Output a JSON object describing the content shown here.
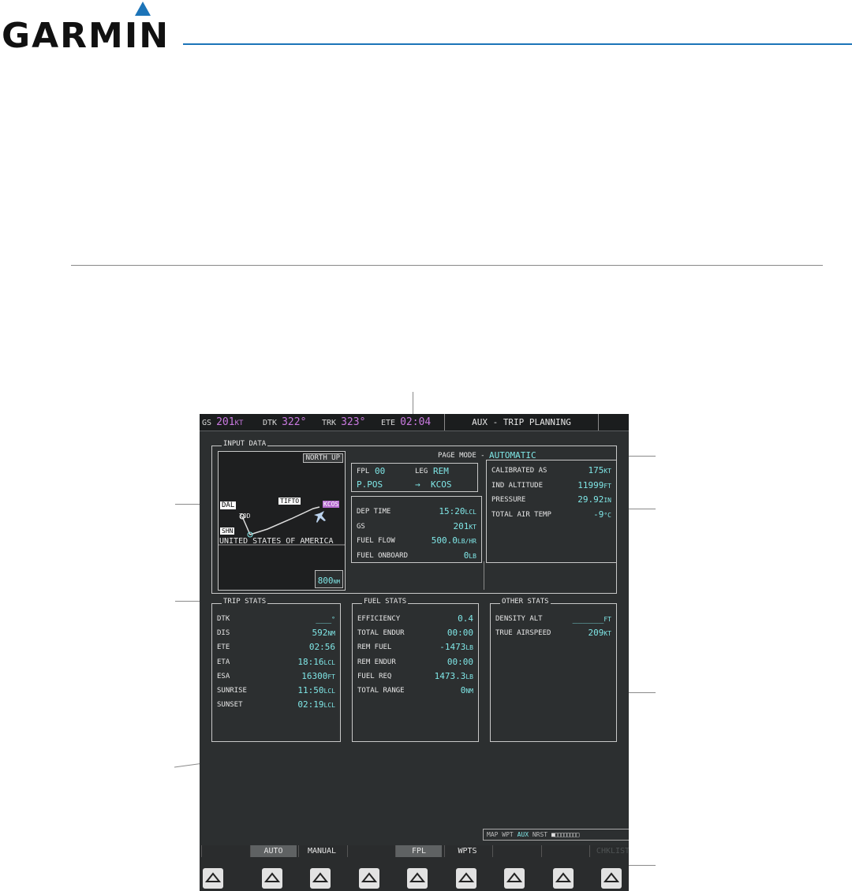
{
  "brand": {
    "name": "GARMIN",
    "reg": "®"
  },
  "topbar": {
    "gs_label": "GS",
    "gs_value": "201",
    "gs_unit": "KT",
    "dtk_label": "DTK",
    "dtk_value": "322°",
    "trk_label": "TRK",
    "trk_value": "323°",
    "ete_label": "ETE",
    "ete_value": "02:04",
    "page_title": "AUX - TRIP PLANNING"
  },
  "input_data": {
    "title": "INPUT DATA",
    "page_mode_label": "PAGE MODE -",
    "page_mode_value": "AUTOMATIC",
    "fpl_label": "FPL",
    "fpl_value": "00",
    "leg_label": "LEG",
    "leg_value": "REM",
    "from": "P.POS",
    "arrow": "→",
    "to": "KCOS",
    "map": {
      "north_up": "NORTH UP",
      "range": "800",
      "range_unit": "NM",
      "labels": {
        "dal": "DAL",
        "shn": "SHN",
        "tifto": "TIFTO",
        "kcos": "KCOS",
        "tod": "TOD",
        "country": "UNITED STATES OF AMERICA"
      }
    },
    "rows": [
      {
        "label": "DEP TIME",
        "value": "15:20",
        "unit": "LCL"
      },
      {
        "label": "GS",
        "value": "201",
        "unit": "KT"
      },
      {
        "label": "FUEL FLOW",
        "value": "500.0",
        "unit": "LB/HR"
      },
      {
        "label": "FUEL ONBOARD",
        "value": "0",
        "unit": "LB"
      }
    ],
    "air_rows": [
      {
        "label": "CALIBRATED AS",
        "value": "175",
        "unit": "KT"
      },
      {
        "label": "IND ALTITUDE",
        "value": "11999",
        "unit": "FT"
      },
      {
        "label": "PRESSURE",
        "value": "29.92",
        "unit": "IN"
      },
      {
        "label": "TOTAL AIR TEMP",
        "value": "-9",
        "unit": "°C"
      }
    ]
  },
  "trip_stats": {
    "title": "TRIP STATS",
    "rows": [
      {
        "label": "DTK",
        "value": "___",
        "unit": "°"
      },
      {
        "label": "DIS",
        "value": "592",
        "unit": "NM"
      },
      {
        "label": "ETE",
        "value": "02:56",
        "unit": ""
      },
      {
        "label": "ETA",
        "value": "18:16",
        "unit": "LCL"
      },
      {
        "label": "ESA",
        "value": "16300",
        "unit": "FT"
      },
      {
        "label": "SUNRISE",
        "value": "11:50",
        "unit": "LCL"
      },
      {
        "label": "SUNSET",
        "value": "02:19",
        "unit": "LCL"
      }
    ]
  },
  "fuel_stats": {
    "title": "FUEL STATS",
    "rows": [
      {
        "label": "EFFICIENCY",
        "value": "0.4",
        "unit": ""
      },
      {
        "label": "TOTAL ENDUR",
        "value": "00:00",
        "unit": ""
      },
      {
        "label": "REM FUEL",
        "value": "-1473",
        "unit": "LB"
      },
      {
        "label": "REM ENDUR",
        "value": "00:00",
        "unit": ""
      },
      {
        "label": "FUEL REQ",
        "value": "1473.3",
        "unit": "LB"
      },
      {
        "label": "TOTAL RANGE",
        "value": "0",
        "unit": "NM"
      }
    ]
  },
  "other_stats": {
    "title": "OTHER STATS",
    "rows": [
      {
        "label": "DENSITY ALT",
        "value": "______",
        "unit": "FT"
      },
      {
        "label": "TRUE AIRSPEED",
        "value": "209",
        "unit": "KT"
      }
    ]
  },
  "page_group": {
    "map": "MAP",
    "wpt": "WPT",
    "aux": "AUX",
    "nrst": "NRST"
  },
  "softkeys": [
    "",
    "AUTO",
    "MANUAL",
    "",
    "FPL",
    "WPTS",
    "",
    "",
    "CHKLIST"
  ]
}
